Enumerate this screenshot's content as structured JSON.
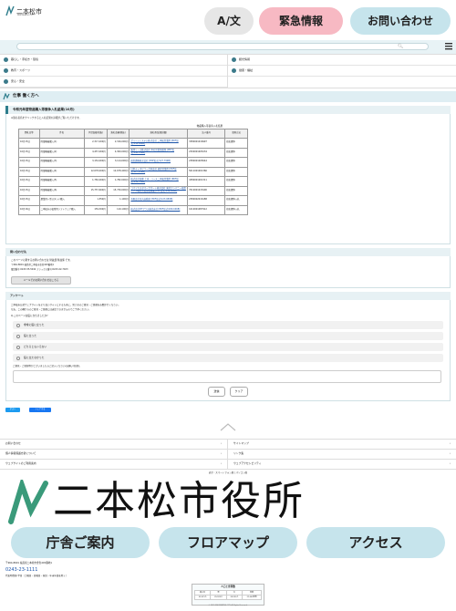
{
  "header": {
    "logo_text": "二本松市",
    "logo_sub": "NIHONMATSU CITY",
    "lang_button": "A/文",
    "emergency_button": "緊急情報",
    "contact_button": "お問い合わせ"
  },
  "search": {
    "placeholder": ""
  },
  "catnav": {
    "left": [
      "暮らし・手続き・環境",
      "教育・スポーツ",
      "安心・安全"
    ],
    "right": [
      "観光情報",
      "健康・福祉"
    ]
  },
  "page": {
    "title": "仕事 働く方へ",
    "article_head": "令和元年度物品購入等競争入札結果(10月)",
    "note": "※落札者名をクリックすると入札結果の詳細がご覧いただけます。",
    "table_caption": "物品購入等競争入札結果",
    "table": {
      "headers": [
        "開札日等",
        "件名",
        "予定価格(税抜)",
        "落札金額(税抜)",
        "落札者(結果詳細)",
        "法人番号",
        "契約方法"
      ],
      "rows": [
        [
          "10月15日",
          "除雪機械購入(1)",
          "2,317,200円",
          "2,316,000円",
          "グリーンシステム株式会社 二本松営業所 [PDF形式/136.89KB]",
          "3380001016997",
          "指名競争"
        ],
        [
          "10月15日",
          "除雪機械購入(2)",
          "4,457,000円",
          "4,300,000円",
          "東邦リース株式会社 本社営業事業所 [PDF形式/140.51KB]",
          "2300001005234",
          "指名競争"
        ],
        [
          "10月15日",
          "除雪機械購入(3)",
          "3,154,000円",
          "3,114,000円",
          "福島農機株式会社 [PDF形式/127.79KB]",
          "2380001005644",
          "指名競争"
        ],
        [
          "10月15日",
          "除雪機械購入(4)",
          "12,678,400円",
          "12,678,400円",
          "日本キャタピラー合同会社 福島営業所 [PDF形式/127.45KB]",
          "5011001001366",
          "指名競争"
        ],
        [
          "10月15日",
          "除雪機械購入(5)",
          "1,782,000円",
          "1,782,000円",
          "株式会社富藤 土木・リース二本松営業所 [PDF形式/136.72KB]",
          "4380001001311",
          "指名競争"
        ],
        [
          "10月15日",
          "除雪機械購入(6)",
          "15,757,600円",
          "15,730,000円",
          "コマツカスタマーサポート株式会社 東北カンパニー福島ミシン福島営業部業務課 [PDF形式/149.06KB]",
          "7010001015400",
          "指名競争"
        ],
        [
          "10月15日",
          "農業用ト型スタンド購入",
          "1,550円",
          "1,100円",
          "有限会社金丸自動車 [PDF形式/123.08KB]",
          "2380002016188",
          "指名競争入札"
        ],
        [
          "10月16日",
          "二本松市の役所用ソフトウェア購入",
          "159,300円",
          "119,100円",
          "株式会社DTプラス東北支社 [PDF形式/180.04KB]",
          "1010001087912",
          "指名競争入札"
        ]
      ]
    }
  },
  "contact": {
    "head": "問い合わせ先",
    "line1": "このページに関するお問い合わせは 財政課 財政係 です。",
    "line2": "〒964-8601 福島県二本松市金色403番地1",
    "line3": "電話番号:0243-55-5042 ファックス番号:0243-22-7023",
    "mail_button": "メールでのお問い合わせはこちら"
  },
  "survey": {
    "head": "アンケート",
    "note1": "二本松市公式ウェブサイトをより良いサイトにするために、皆さまのご意見・ご感想をお聞かせください。",
    "note2": "なお、この欄からのご意見・ご感想には返信できませんのでご了承ください。",
    "question": "Q.このページは役に立ちましたか?",
    "options": [
      "非常に役に立った",
      "役に立った",
      "どちらともいえない",
      "役に立たなかった"
    ],
    "comment_label": "ご意見・ご感想等がございましたらご記入ください(お願い/任意)。",
    "submit": "送信",
    "clear": "クリア"
  },
  "share": {
    "x": "ポスト",
    "fb": "シェアする"
  },
  "footer": {
    "links_left": [
      "お問い合わせ",
      "個人情報保護方針について",
      "ウェブサイトのご利用案内"
    ],
    "links_right": [
      "サイトマップ",
      "リンク集",
      "ウェブアクセシビリティ"
    ],
    "sub": "表示 : スマートフォン版 | パソコン版",
    "city_name": "二本松市役所",
    "btn_office": "庁舎ご案内",
    "btn_floor": "フロアマップ",
    "btn_access": "アクセス",
    "address": "〒964-8601 福島県二本松市金色403番地1",
    "tel": "0243-23-1111",
    "hours": "代表時間帯:平日（土曜日・日曜日・祝日・年末年始を除く）",
    "pop_title": "人口と世帯数",
    "pop_labels": [
      "総人口",
      "男",
      "女",
      "世帯"
    ],
    "pop_values": [
      "52,521人",
      "25,599人",
      "26,922人",
      "21,063世帯"
    ],
    "copyright": "© 2019 NIHONMATSU CITY. All Rights Reserved."
  },
  "colors": {
    "emergency": "#f7b9c3",
    "accent": "#c6e4ec",
    "link": "#1a53a8"
  }
}
